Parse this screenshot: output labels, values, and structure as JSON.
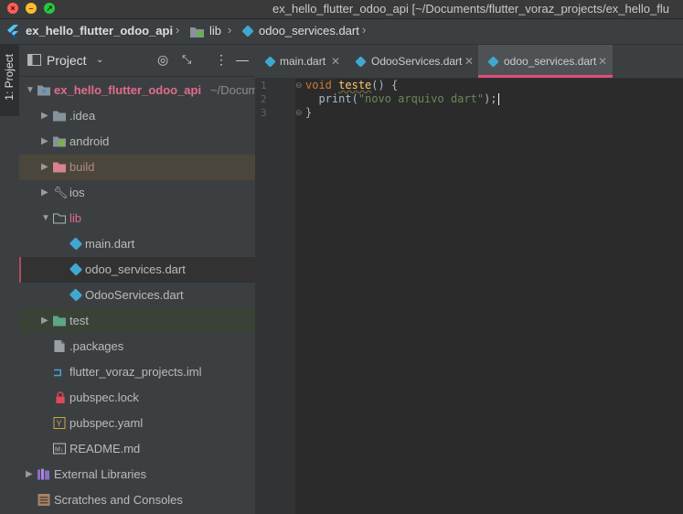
{
  "window": {
    "title": "ex_hello_flutter_odoo_api [~/Documents/flutter_voraz_projects/ex_hello_flu",
    "controls": [
      "close",
      "minimize",
      "maximize"
    ]
  },
  "breadcrumb": {
    "project": "ex_hello_flutter_odoo_api",
    "folder": "lib",
    "file": "odoo_services.dart"
  },
  "toolstrip": {
    "project_tab": "1: Project"
  },
  "project_panel": {
    "title": "Project",
    "root": {
      "name": "ex_hello_flutter_odoo_api",
      "path": "~/Docum"
    },
    "items": [
      {
        "label": ".idea"
      },
      {
        "label": "android"
      },
      {
        "label": "build"
      },
      {
        "label": "ios"
      },
      {
        "label": "lib"
      },
      {
        "label": "main.dart"
      },
      {
        "label": "odoo_services.dart"
      },
      {
        "label": "OdooServices.dart"
      },
      {
        "label": "test"
      },
      {
        "label": ".packages"
      },
      {
        "label": "flutter_voraz_projects.iml"
      },
      {
        "label": "pubspec.lock"
      },
      {
        "label": "pubspec.yaml"
      },
      {
        "label": "README.md"
      },
      {
        "label": "External Libraries"
      },
      {
        "label": "Scratches and Consoles"
      }
    ]
  },
  "editor": {
    "tabs": [
      {
        "label": "main.dart"
      },
      {
        "label": "OdooServices.dart"
      },
      {
        "label": "odoo_services.dart",
        "active": true
      }
    ],
    "line_numbers": [
      "1",
      "2",
      "3"
    ],
    "code": {
      "l1_kw": "void",
      "l1_fn": "teste",
      "l1_rest": "() {",
      "l2_indent": "  ",
      "l2_call": "print(",
      "l2_str": "\"novo arquivo dart\"",
      "l2_end": ");",
      "l3": "}"
    }
  },
  "colors": {
    "accent": "#e14d79",
    "dart_icon": "#40a8d0",
    "keyword": "#cc7832",
    "function": "#ffc66d",
    "string": "#6a8759"
  }
}
